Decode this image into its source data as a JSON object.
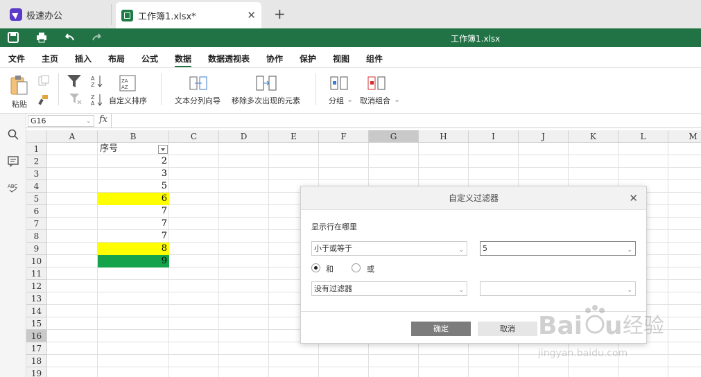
{
  "tabs": [
    {
      "label": "极速办公",
      "icon": "rocket-app-icon"
    },
    {
      "label": "工作簿1.xlsx*",
      "icon": "spreadsheet-icon",
      "close": "✕"
    }
  ],
  "new_tab": "+",
  "window_title": "工作簿1.xlsx",
  "menu": [
    "文件",
    "主页",
    "插入",
    "布局",
    "公式",
    "数据",
    "数据透视表",
    "协作",
    "保护",
    "视图",
    "组件"
  ],
  "active_menu": "数据",
  "ribbon": {
    "paste": "粘贴",
    "custom_sort": "自定义排序",
    "text_to_columns": "文本分列向导",
    "remove_duplicates": "移除多次出现的元素",
    "group": "分组",
    "ungroup": "取消组合"
  },
  "name_box": "G16",
  "fx": "fx",
  "columns": [
    "A",
    "B",
    "C",
    "D",
    "E",
    "F",
    "G",
    "H",
    "I",
    "J",
    "K",
    "L",
    "M"
  ],
  "selected_column": "G",
  "rows": [
    "1",
    "2",
    "3",
    "4",
    "5",
    "6",
    "7",
    "8",
    "9",
    "10",
    "11",
    "12",
    "13",
    "14",
    "15",
    "16",
    "17",
    "18",
    "19"
  ],
  "selected_row": "16",
  "cells": {
    "header": "序号",
    "values": [
      "2",
      "3",
      "5",
      "6",
      "7",
      "7",
      "7",
      "8",
      "9"
    ],
    "highlight": {
      "yellow": "#ffff00",
      "green": "#14a34a"
    }
  },
  "dialog": {
    "title": "自定义过滤器",
    "close": "✕",
    "label": "显示行在哪里",
    "cond1_operator": "小于或等于",
    "cond1_value": "5",
    "and_label": "和",
    "or_label": "或",
    "cond2_operator": "没有过滤器",
    "cond2_value": "",
    "ok": "确定",
    "cancel": "取消"
  },
  "watermark": {
    "brand": "Baidu经验",
    "url": "jingyan.baidu.com"
  },
  "colors": {
    "titlebar": "#217346",
    "ok_button": "#7c7c7c"
  }
}
